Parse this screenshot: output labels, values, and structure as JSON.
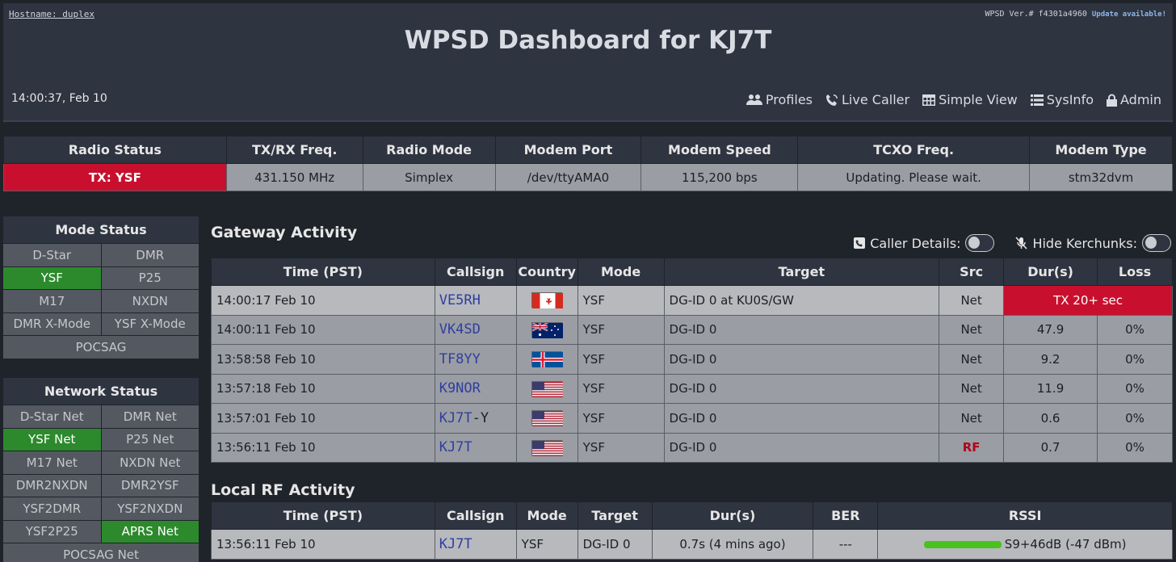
{
  "header": {
    "hostname": "Hostname: duplex",
    "version": "WPSD Ver.# f4301a4960",
    "update": "Update available!",
    "title": "WPSD Dashboard for KJ7T",
    "clock": "14:00:37, Feb 10",
    "nav": [
      {
        "label": "Profiles",
        "icon": "users-icon"
      },
      {
        "label": "Live Caller",
        "icon": "phone-wave-icon"
      },
      {
        "label": "Simple View",
        "icon": "table-icon"
      },
      {
        "label": "SysInfo",
        "icon": "list-icon"
      },
      {
        "label": "Admin",
        "icon": "lock-icon"
      }
    ]
  },
  "radio": {
    "headers": [
      "Radio Status",
      "TX/RX Freq.",
      "Radio Mode",
      "Modem Port",
      "Modem Speed",
      "TCXO Freq.",
      "Modem Type"
    ],
    "values": [
      "TX: YSF",
      "431.150 MHz",
      "Simplex",
      "/dev/ttyAMA0",
      "115,200 bps",
      "Updating. Please wait.",
      "stm32dvm"
    ],
    "status_color": "#c8102e"
  },
  "mode_status": {
    "title": "Mode Status",
    "items": [
      {
        "label": "D-Star",
        "on": false
      },
      {
        "label": "DMR",
        "on": false
      },
      {
        "label": "YSF",
        "on": true
      },
      {
        "label": "P25",
        "on": false
      },
      {
        "label": "M17",
        "on": false
      },
      {
        "label": "NXDN",
        "on": false
      },
      {
        "label": "DMR X-Mode",
        "on": false
      },
      {
        "label": "YSF X-Mode",
        "on": false
      },
      {
        "label": "POCSAG",
        "on": false
      }
    ]
  },
  "network_status": {
    "title": "Network Status",
    "items": [
      {
        "label": "D-Star Net",
        "on": false
      },
      {
        "label": "DMR Net",
        "on": false
      },
      {
        "label": "YSF Net",
        "on": true
      },
      {
        "label": "P25 Net",
        "on": false
      },
      {
        "label": "M17 Net",
        "on": false
      },
      {
        "label": "NXDN Net",
        "on": false
      },
      {
        "label": "DMR2NXDN",
        "on": false
      },
      {
        "label": "DMR2YSF",
        "on": false
      },
      {
        "label": "YSF2DMR",
        "on": false
      },
      {
        "label": "YSF2NXDN",
        "on": false
      },
      {
        "label": "YSF2P25",
        "on": false
      },
      {
        "label": "APRS Net",
        "on": true
      },
      {
        "label": "POCSAG Net",
        "on": false
      }
    ]
  },
  "gateway": {
    "title": "Gateway Activity",
    "caller_details": "Caller Details:",
    "hide_kerchunks": "Hide Kerchunks:",
    "headers": [
      "Time (PST)",
      "Callsign",
      "Country",
      "Mode",
      "Target",
      "Src",
      "Dur(s)",
      "Loss"
    ],
    "rows": [
      {
        "time": "14:00:17 Feb 10",
        "callsign": "VE5RH",
        "suffix": "",
        "flag": "ca",
        "mode": "YSF",
        "target": "DG-ID 0 at KU0S/GW",
        "src": "Net",
        "dur": "TX 20+ sec",
        "loss": ""
      },
      {
        "time": "14:00:11 Feb 10",
        "callsign": "VK4SD",
        "suffix": "",
        "flag": "au",
        "mode": "YSF",
        "target": "DG-ID 0",
        "src": "Net",
        "dur": "47.9",
        "loss": "0%"
      },
      {
        "time": "13:58:58 Feb 10",
        "callsign": "TF8YY",
        "suffix": "",
        "flag": "is",
        "mode": "YSF",
        "target": "DG-ID 0",
        "src": "Net",
        "dur": "9.2",
        "loss": "0%"
      },
      {
        "time": "13:57:18 Feb 10",
        "callsign": "K9NOR",
        "suffix": "",
        "flag": "us",
        "mode": "YSF",
        "target": "DG-ID 0",
        "src": "Net",
        "dur": "11.9",
        "loss": "0%"
      },
      {
        "time": "13:57:01 Feb 10",
        "callsign": "KJ7T",
        "suffix": "-Y",
        "flag": "us",
        "mode": "YSF",
        "target": "DG-ID 0",
        "src": "Net",
        "dur": "0.6",
        "loss": "0%"
      },
      {
        "time": "13:56:11 Feb 10",
        "callsign": "KJ7T",
        "suffix": "",
        "flag": "us",
        "mode": "YSF",
        "target": "DG-ID 0",
        "src": "RF",
        "dur": "0.7",
        "loss": "0%"
      }
    ]
  },
  "local_rf": {
    "title": "Local RF Activity",
    "headers": [
      "Time (PST)",
      "Callsign",
      "Mode",
      "Target",
      "Dur(s)",
      "BER",
      "RSSI"
    ],
    "rows": [
      {
        "time": "13:56:11 Feb 10",
        "callsign": "KJ7T",
        "mode": "YSF",
        "target": "DG-ID 0",
        "dur": "0.7s (4 mins ago)",
        "ber": "---",
        "rssi": "S9+46dB (-47 dBm)",
        "rssi_level": 1.0
      }
    ],
    "rssi_color": "#49c21f"
  }
}
